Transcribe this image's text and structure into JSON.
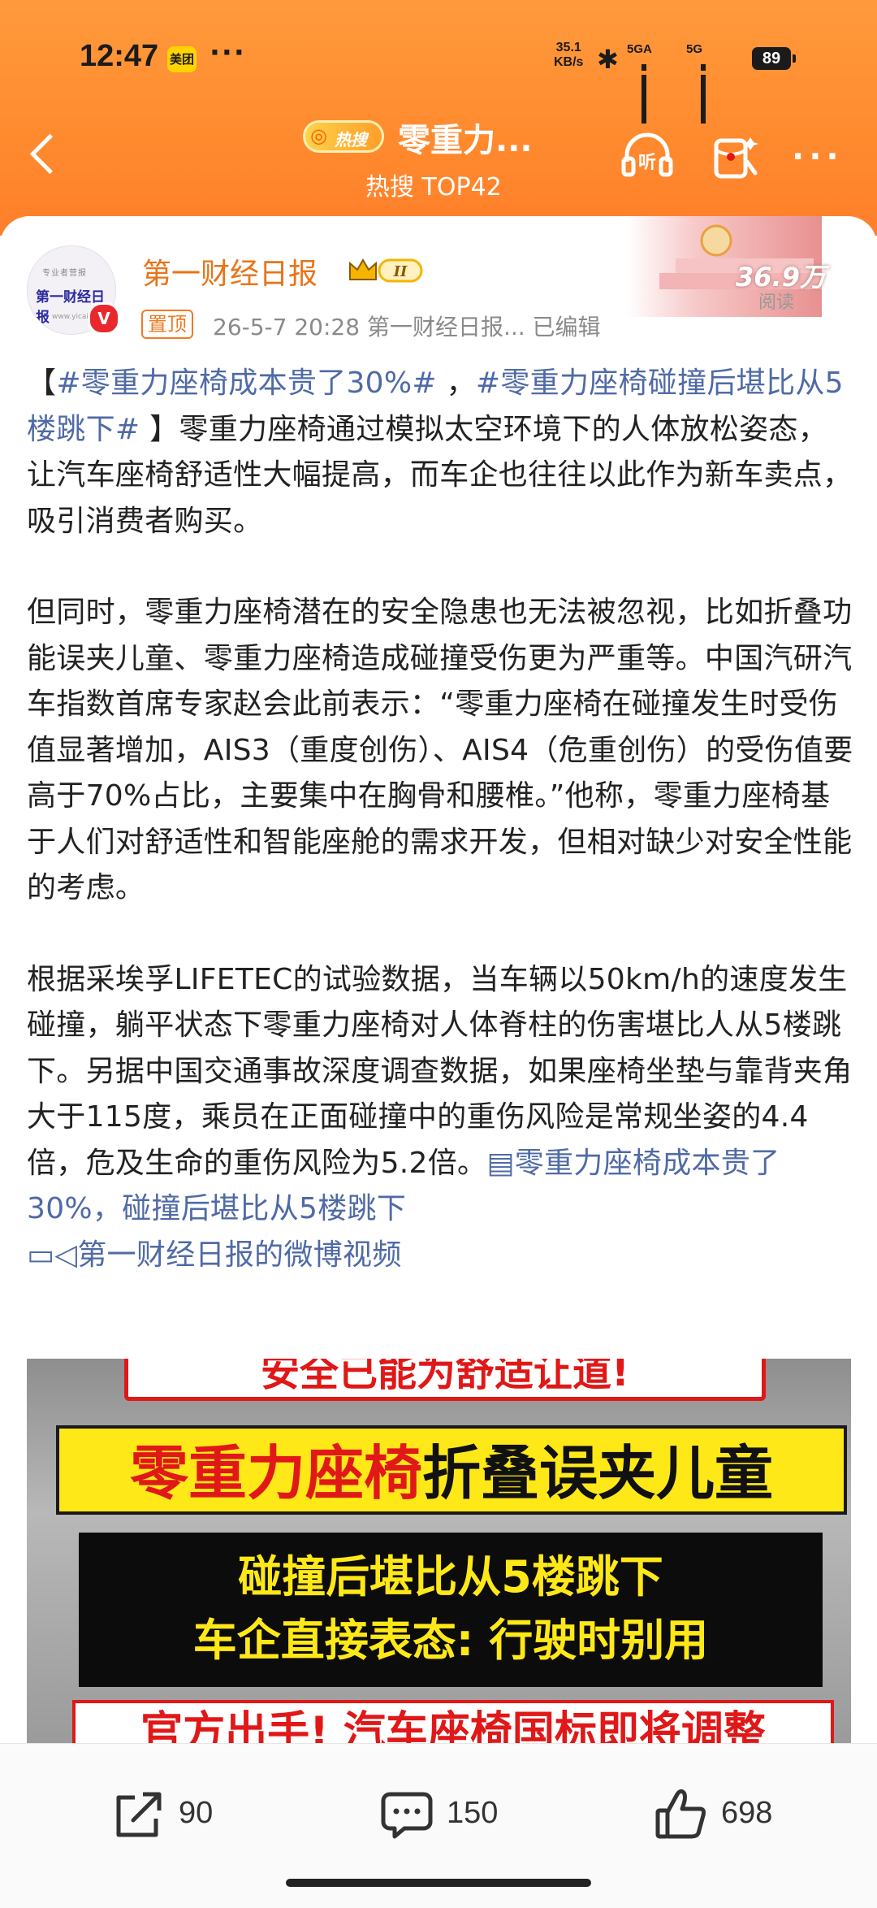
{
  "status_bar": {
    "time": "12:47",
    "app_badge": "美团",
    "dots": "···",
    "speed_value": "35.1",
    "speed_unit": "KB/s",
    "sim1_label": "5GA",
    "sim2_label": "5G",
    "battery": "89"
  },
  "nav": {
    "hot_badge": "热搜",
    "title": "零重力...",
    "subtitle": "热搜 TOP42",
    "more": "···"
  },
  "post": {
    "author": "第一财经日报",
    "badge_level": "II",
    "avatar_text_top": "专业者营报",
    "avatar_text_main": "第一财经日报",
    "avatar_text_bottom": "www.yicai.com",
    "verify_mark": "V",
    "pin_label": "置顶",
    "meta": "26-5-7 20:28  第一财经日报...  已编辑",
    "read_count": "36.9万",
    "read_label": "阅读",
    "para1_open": "【",
    "topic1": "#零重力座椅成本贵了30%#",
    "sep": " ，",
    "topic2": "#零重力座椅碰撞后堪比从5楼跳下#",
    "para1_rest": " 】零重力座椅通过模拟太空环境下的人体放松姿态，让汽车座椅舒适性大幅提高，而车企也往往以此作为新车卖点，吸引消费者购买。",
    "para2": "但同时，零重力座椅潜在的安全隐患也无法被忽视，比如折叠功能误夹儿童、零重力座椅造成碰撞受伤更为严重等。中国汽研汽车指数首席专家赵会此前表示：“零重力座椅在碰撞发生时受伤值显著增加，AIS3（重度创伤）、AIS4（危重创伤）的受伤值要高于70%占比，主要集中在胸骨和腰椎。”他称，零重力座椅基于人们对舒适性和智能座舱的需求开发，但相对缺少对安全性能的考虑。",
    "para3": "根据采埃孚LIFETEC的试验数据，当车辆以50km/h的速度发生碰撞，躺平状态下零重力座椅对人体脊柱的伤害堪比人从5楼跳下。另据中国交通事故深度调查数据，如果座椅坐垫与靠背夹角大于115度，乘员在正面碰撞中的重伤风险是常规坐姿的4.4倍，危及生命的重伤风险为5.2倍。",
    "article_link": "零重力座椅成本贵了30%，碰撞后堪比从5楼跳下",
    "video_link": "第一财经日报的微博视频"
  },
  "video": {
    "line1": "安全已能为舒适让道!",
    "line2_red": "零重力座椅",
    "line2_black": "折叠误夹儿童",
    "line3a": "碰撞后堪比从5楼跳下",
    "line3b": "车企直接表态: 行驶时别用",
    "line4": "官方出手! 汽车座椅国标即将调整"
  },
  "actions": {
    "repost_count": "90",
    "comment_count": "150",
    "like_count": "698"
  },
  "colors": {
    "header_orange": "#ff8a2e",
    "author_orange": "#e8741a",
    "link_blue": "#4f6aa6",
    "video_yellow": "#ffe818",
    "video_red": "#e01818"
  }
}
